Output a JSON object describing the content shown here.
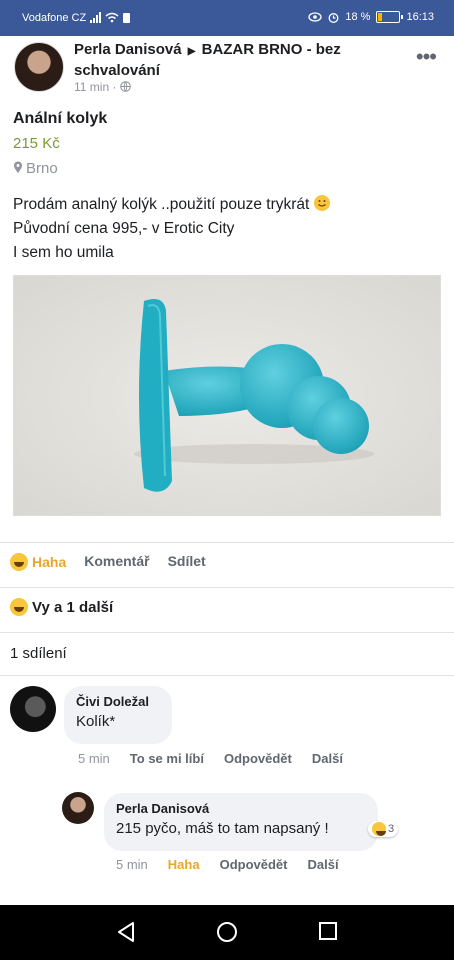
{
  "status_bar": {
    "carrier": "Vodafone CZ",
    "battery": "18 %",
    "time": "16:13"
  },
  "post": {
    "author": "Perla Danisová",
    "group": "BAZAR BRNO - bez schvalování",
    "time": "11 min",
    "title": "Anální kolyk",
    "price": "215 Kč",
    "location": "Brno",
    "body_lines": [
      "Prodám analný kolýk ..použití pouze trykrát",
      "Původní cena 995,- v Erotic City",
      "I sem ho umila"
    ]
  },
  "actions": {
    "haha": "Haha",
    "comment": "Komentář",
    "share": "Sdílet"
  },
  "reactions": {
    "text": "Vy a 1 další"
  },
  "shares": {
    "text": "1 sdílení"
  },
  "comments": [
    {
      "author": "Čivi Doležal",
      "text": "Kolík*",
      "time": "5 min",
      "like": "To se mi líbí",
      "reply": "Odpovědět",
      "more": "Další"
    },
    {
      "author": "Perla Danisová",
      "text": "215 pyčo, máš to tam napsaný !",
      "time": "5 min",
      "reaction": "Haha",
      "reply": "Odpovědět",
      "more": "Další",
      "reaction_count": "3"
    }
  ],
  "colors": {
    "brand": "#3b5998",
    "haha": "#e8a62b",
    "price": "#7a9a3a"
  }
}
